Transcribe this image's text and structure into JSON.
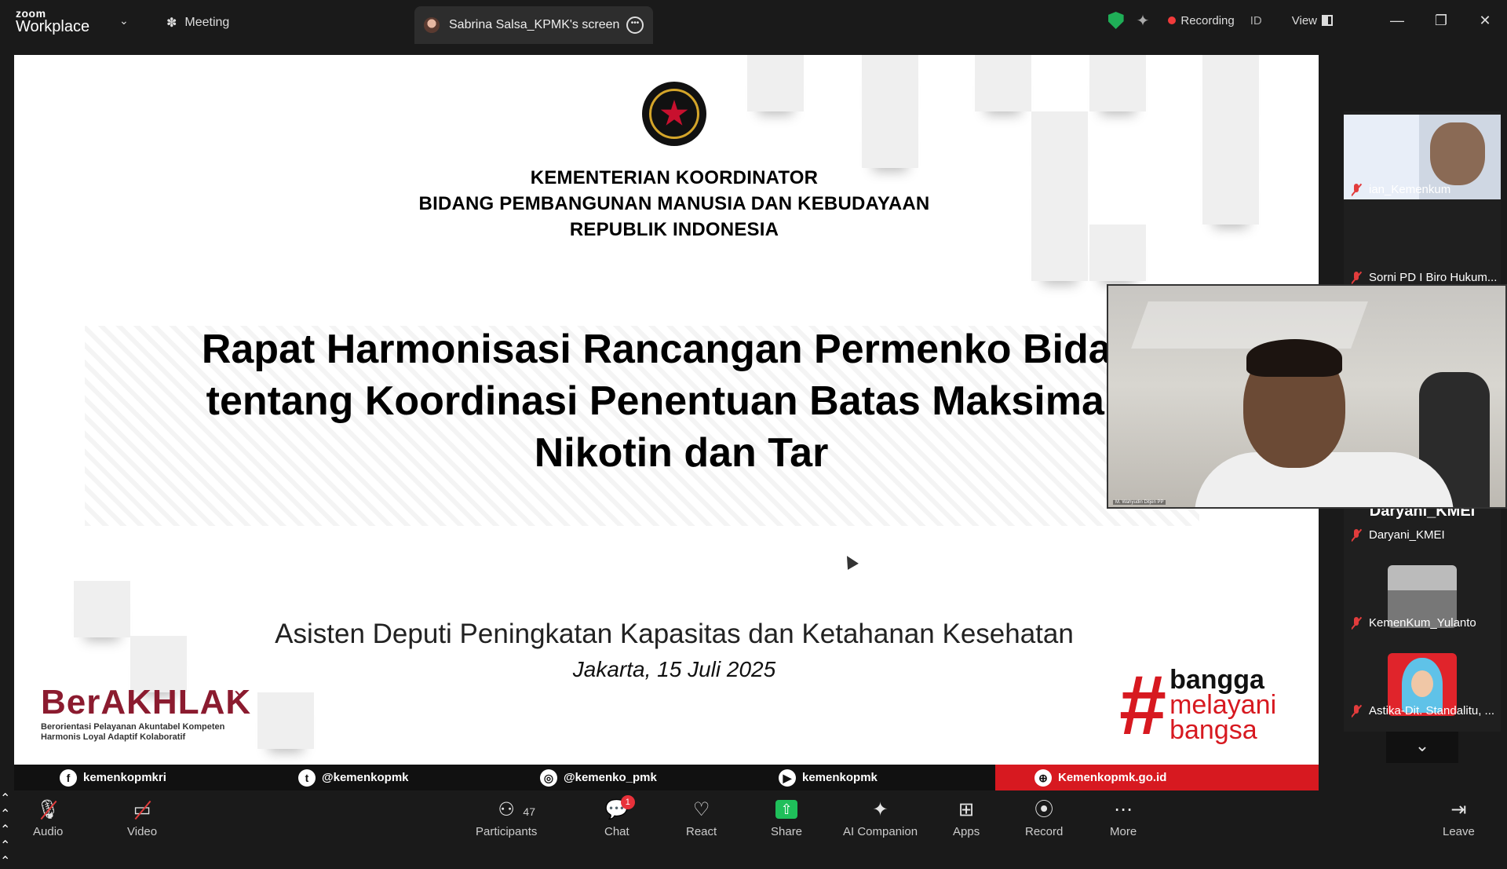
{
  "app": {
    "logo_line1": "zoom",
    "logo_line2": "Workplace"
  },
  "tabs": {
    "meeting": "Meeting",
    "screen": "Sabrina Salsa_KPMK's screen"
  },
  "status": {
    "recording": "Recording",
    "id": "ID",
    "view": "View"
  },
  "colors": {
    "accent_red": "#d71920",
    "akhlak": "#8b1b2f",
    "share_green": "#1fbf5a",
    "secure_green": "#1fae57"
  },
  "slide": {
    "ministry": [
      "KEMENTERIAN KOORDINATOR",
      "BIDANG PEMBANGUNAN MANUSIA DAN KEBUDAYAAN",
      "REPUBLIK INDONESIA"
    ],
    "title_lines": [
      "Rapat Harmonisasi Rancangan Permenko Bidang",
      "tentang Koordinasi Penentuan Batas Maksimal K",
      "Nikotin dan Tar"
    ],
    "subtitle": "Asisten Deputi Peningkatan Kapasitas dan Ketahanan Kesehatan",
    "date": "Jakarta, 15 Juli 2025",
    "akhlak": {
      "brand": "BerAKHLAK",
      "line1": "Berorientasi Pelayanan Akuntabel Kompeten",
      "line2": "Harmonis Loyal Adaptif Kolaboratif"
    },
    "bangga": {
      "hash": "#",
      "w1": "bangga",
      "w2": "melayani",
      "w3": "bangsa"
    },
    "social": [
      {
        "icon": "f",
        "label": "kemenkopmkri"
      },
      {
        "icon": "t",
        "label": "@kemenkopmk"
      },
      {
        "icon": "◎",
        "label": "@kemenko_pmk"
      },
      {
        "icon": "▶",
        "label": "kemenkopmk"
      },
      {
        "icon": "⊕",
        "label": "Kemenkopmk.go.id"
      }
    ]
  },
  "speaker": {
    "name": "M. Wahyudin Ditjen PP"
  },
  "participants": [
    {
      "name": "ian_Kemenkum"
    },
    {
      "name": "Sorni PD I Biro Hukum..."
    },
    {
      "name": "Daryani_KMEI",
      "big_name": "Daryani_KMEI"
    },
    {
      "name": "KemenKum_Yulanto"
    },
    {
      "name": "Astika-Dit. Standalitu, ..."
    }
  ],
  "toolbar": {
    "audio": "Audio",
    "video": "Video",
    "participants": "Participants",
    "participants_count": "47",
    "chat": "Chat",
    "chat_badge": "1",
    "react": "React",
    "share": "Share",
    "ai": "AI Companion",
    "apps": "Apps",
    "record": "Record",
    "more": "More",
    "leave": "Leave"
  }
}
